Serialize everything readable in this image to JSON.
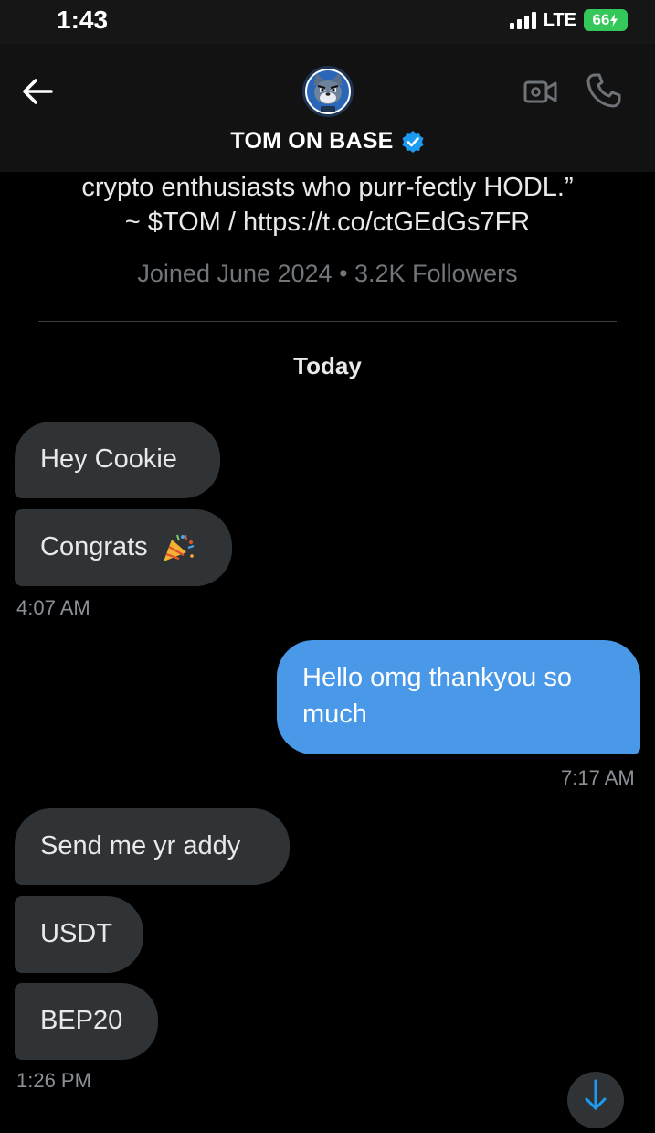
{
  "status_bar": {
    "time": "1:43",
    "network": "LTE",
    "battery": "66"
  },
  "header": {
    "name": "TOM ON BASE",
    "back_icon": "arrow-left-icon",
    "video_icon": "video-camera-icon",
    "call_icon": "phone-icon",
    "verified_icon": "verified-badge-icon",
    "verified_color": "#1d9bf0"
  },
  "profile": {
    "bio_line1": "crypto enthusiasts who purr-fectly HODL.”",
    "bio_line2": "~ $TOM / https://t.co/ctGEdGs7FR",
    "joined": "Joined June 2024 • 3.2K Followers"
  },
  "conversation": {
    "day_label": "Today",
    "messages": [
      {
        "text": "Hey Cookie",
        "direction": "incoming"
      },
      {
        "text": "Congrats",
        "emoji": "party-popper-icon",
        "direction": "incoming",
        "time": "4:07 AM"
      },
      {
        "text": "Hello omg thankyou so much",
        "line1": "Hello omg thankyou so",
        "line2": "much",
        "direction": "outgoing",
        "time": "7:17 AM"
      },
      {
        "text": "Send me yr addy",
        "direction": "incoming"
      },
      {
        "text": "USDT",
        "direction": "incoming"
      },
      {
        "text": "BEP20",
        "direction": "incoming",
        "time": "1:26 PM"
      }
    ]
  },
  "colors": {
    "background": "#000000",
    "incoming_bubble": "#2f3336",
    "outgoing_bubble": "#4a99e9",
    "battery": "#34c759"
  }
}
